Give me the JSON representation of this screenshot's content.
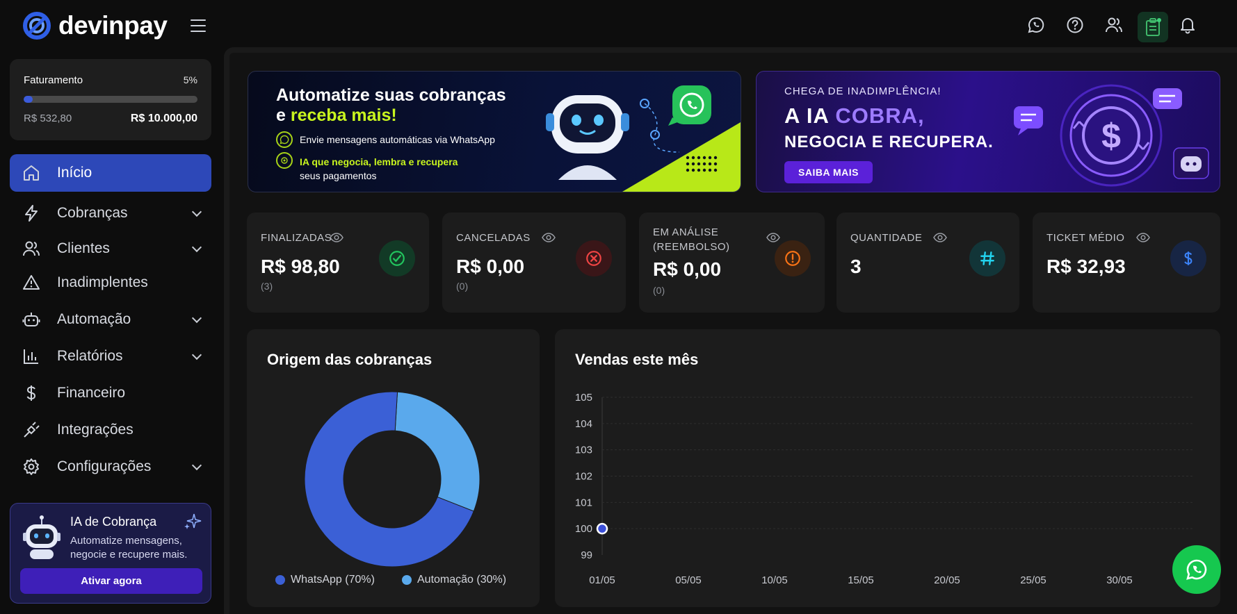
{
  "brand": {
    "name": "devinpay"
  },
  "billing": {
    "label": "Faturamento",
    "percent_text": "5%",
    "progress": 0.05,
    "current": "R$ 532,80",
    "max": "R$ 10.000,00"
  },
  "nav": [
    {
      "label": "Início",
      "icon": "home-icon",
      "active": true,
      "chevron": false
    },
    {
      "label": "Cobranças",
      "icon": "lightning-icon",
      "active": false,
      "chevron": true
    },
    {
      "label": "Clientes",
      "icon": "users-icon",
      "active": false,
      "chevron": true
    },
    {
      "label": "Inadimplentes",
      "icon": "warning-icon",
      "active": false,
      "chevron": false
    },
    {
      "label": "Automação",
      "icon": "robot-icon",
      "active": false,
      "chevron": true
    },
    {
      "label": "Relatórios",
      "icon": "bar-chart-icon",
      "active": false,
      "chevron": true
    },
    {
      "label": "Financeiro",
      "icon": "dollar-icon",
      "active": false,
      "chevron": false
    },
    {
      "label": "Integrações",
      "icon": "plug-icon",
      "active": false,
      "chevron": false
    },
    {
      "label": "Configurações",
      "icon": "gear-icon",
      "active": false,
      "chevron": true
    }
  ],
  "ai_card": {
    "title": "IA de Cobrança",
    "description": "Automatize mensagens, negocie e recupere mais.",
    "button": "Ativar agora"
  },
  "topbar_icons": [
    "whatsapp-icon",
    "help-icon",
    "users-icon",
    "clipboard-icon",
    "bell-icon"
  ],
  "banner1": {
    "title_a": "Automatize suas cobranças",
    "title_b_prefix": "e ",
    "title_b_highlight": "receba mais!",
    "line1": "Envie mensagens automáticas via WhatsApp",
    "line2_highlight": "IA que negocia, lembra e recupera",
    "line2_rest": "seus pagamentos"
  },
  "banner2": {
    "small": "CHEGA DE INADIMPLÊNCIA!",
    "big_prefix": "A IA ",
    "big_highlight": "COBRA,",
    "mid": "NEGOCIA E RECUPERA.",
    "button": "SAIBA MAIS"
  },
  "stats": [
    {
      "label": "FINALIZADAS",
      "value": "R$ 98,80",
      "count": "(3)",
      "icon": "check-icon",
      "color": "#22c55e",
      "bg": "#123a26"
    },
    {
      "label": "CANCELADAS",
      "value": "R$ 0,00",
      "count": "(0)",
      "icon": "x-circle-icon",
      "color": "#ef4444",
      "bg": "#3a1618"
    },
    {
      "label": "EM ANÁLISE",
      "label2": "(REEMBOLSO)",
      "value": "R$ 0,00",
      "count": "(0)",
      "icon": "alert-icon",
      "color": "#f97316",
      "bg": "#3a2212"
    },
    {
      "label": "QUANTIDADE",
      "value": "3",
      "count": "",
      "icon": "hash-icon",
      "color": "#22d3ee",
      "bg": "#123538"
    },
    {
      "label": "TICKET MÉDIO",
      "value": "R$ 32,93",
      "count": "",
      "icon": "dollar-icon",
      "color": "#3b82f6",
      "bg": "#172544"
    }
  ],
  "origin_card": {
    "title": "Origem das cobranças"
  },
  "sales_card": {
    "title": "Vendas este mês"
  },
  "chart_data": [
    {
      "type": "pie",
      "title": "Origem das cobranças",
      "categories": [
        "WhatsApp (70%)",
        "Automação (30%)"
      ],
      "values": [
        70,
        30
      ],
      "colors": [
        "#3b60d6",
        "#5aa9ec"
      ],
      "donut": true,
      "legend": "bottom"
    },
    {
      "type": "line",
      "title": "Vendas este mês",
      "x_ticks": [
        "01/05",
        "05/05",
        "10/05",
        "15/05",
        "20/05",
        "25/05",
        "30/05"
      ],
      "y_ticks": [
        99,
        100,
        101,
        102,
        103,
        104,
        105
      ],
      "ylim": [
        99,
        105
      ],
      "series": [
        {
          "x": [
            "01/05"
          ],
          "values": [
            100
          ],
          "color": "#3b4fd8"
        }
      ],
      "grid": true
    }
  ]
}
